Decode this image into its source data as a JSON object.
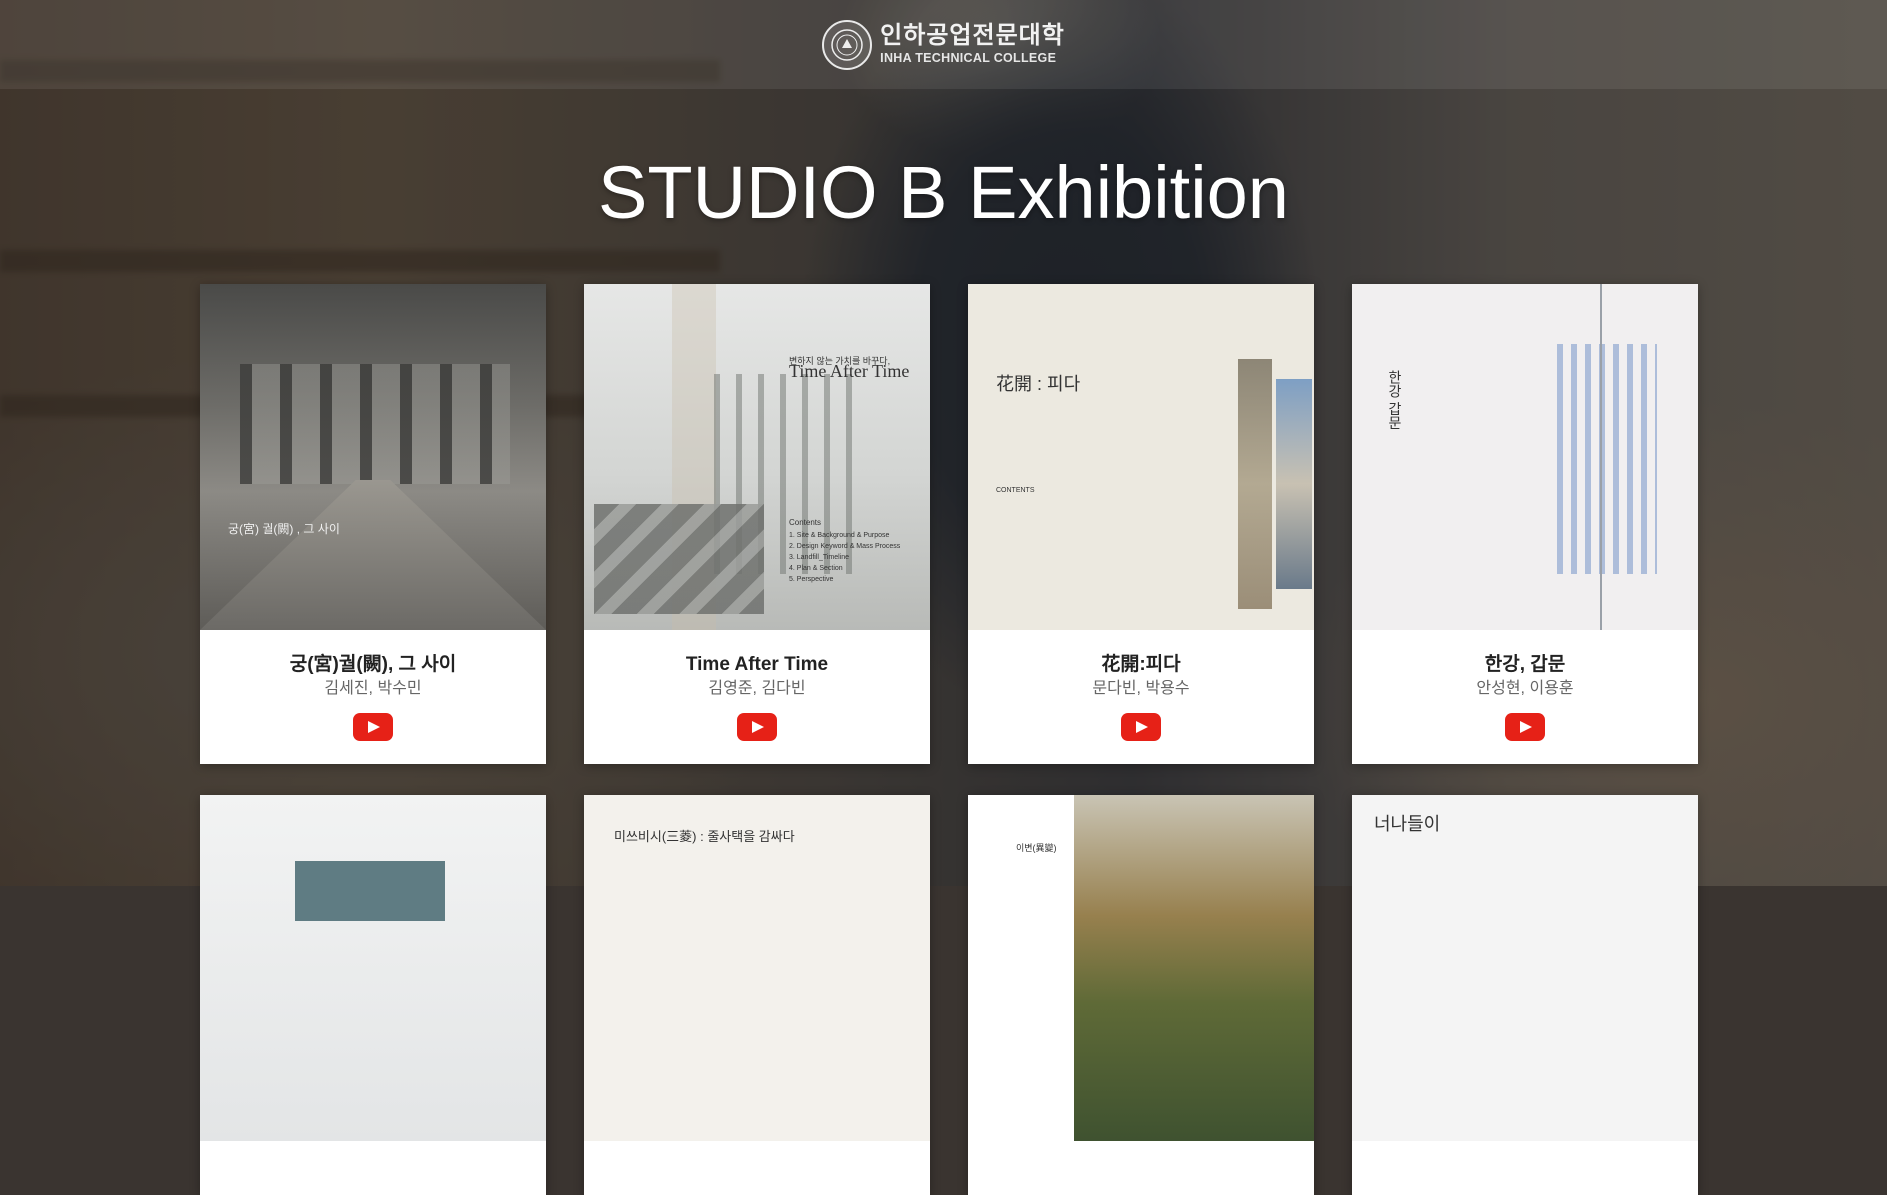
{
  "header": {
    "logo_korean": "인하공업전문대학",
    "logo_english": "INHA TECHNICAL COLLEGE"
  },
  "page": {
    "title": "STUDIO B Exhibition"
  },
  "cards": [
    {
      "title": "궁(宮)궐(闕), 그 사이",
      "authors": "김세진, 박수민",
      "thumb_text": [
        "궁(宮) 궐(闕) , 그 사이"
      ]
    },
    {
      "title": "Time After Time",
      "authors": "김영준, 김다빈",
      "thumb_text": [
        "변하지 않는 가치를 바꾸다,",
        "Time After Time",
        "Contents",
        "1. Site & Background & Purpose",
        "2. Design Keyword & Mass Process",
        "3. Landfill_Timeline",
        "4. Plan & Section",
        "5. Perspective"
      ]
    },
    {
      "title": "花開:피다",
      "authors": "문다빈, 박용수",
      "thumb_text": [
        "花開 : 피다",
        "CONTENTS"
      ]
    },
    {
      "title": "한강, 갑문",
      "authors": "안성현, 이용훈",
      "thumb_text": [
        "한강 갑문"
      ]
    },
    {
      "title": "",
      "authors": "",
      "thumb_text": []
    },
    {
      "title": "",
      "authors": "",
      "thumb_text": [
        "미쓰비시(三菱) : 줄사택을 감싸다"
      ]
    },
    {
      "title": "",
      "authors": "",
      "thumb_text": [
        "이변(異變)"
      ]
    },
    {
      "title": "",
      "authors": "",
      "thumb_text": [
        "너나들이"
      ]
    }
  ],
  "icons": {
    "play": "youtube-play-icon",
    "seal": "college-seal-icon"
  },
  "colors": {
    "youtube_red": "#e62117",
    "card_bg": "#ffffff",
    "title_text": "#ffffff"
  }
}
